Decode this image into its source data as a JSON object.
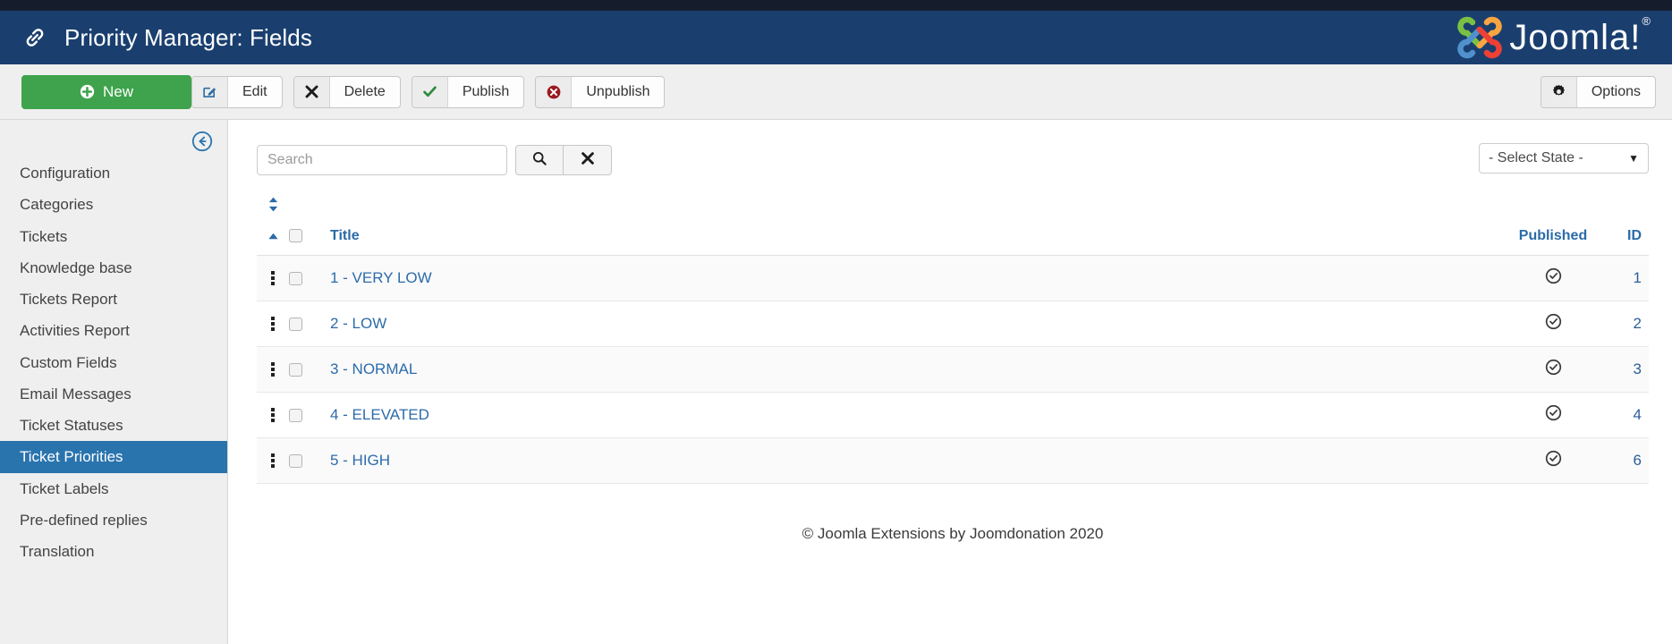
{
  "header": {
    "title": "Priority Manager: Fields",
    "icon": "chain-link-icon",
    "brand": "Joomla!",
    "brand_registered": "®",
    "bar_color": "#1a3f6f"
  },
  "toolbar": {
    "new_label": "New",
    "new_icon": "plus-circle-icon",
    "new_color": "#3ea34c",
    "edit_label": "Edit",
    "edit_icon": "pencil-square-icon",
    "delete_label": "Delete",
    "delete_icon": "x-mark-icon",
    "publish_label": "Publish",
    "publish_icon": "check-mark-icon",
    "unpublish_label": "Unpublish",
    "unpublish_icon": "circle-x-icon",
    "options_label": "Options",
    "options_icon": "gear-icon"
  },
  "sidebar": {
    "collapse_icon": "arrow-circle-left-icon",
    "active_color": "#2a74ae",
    "items": [
      {
        "label": "Configuration",
        "active": false
      },
      {
        "label": "Categories",
        "active": false
      },
      {
        "label": "Tickets",
        "active": false
      },
      {
        "label": "Knowledge base",
        "active": false
      },
      {
        "label": "Tickets Report",
        "active": false
      },
      {
        "label": "Activities Report",
        "active": false
      },
      {
        "label": "Custom Fields",
        "active": false
      },
      {
        "label": "Email Messages",
        "active": false
      },
      {
        "label": "Ticket Statuses",
        "active": false
      },
      {
        "label": "Ticket Priorities",
        "active": true
      },
      {
        "label": "Ticket Labels",
        "active": false
      },
      {
        "label": "Pre-defined replies",
        "active": false
      },
      {
        "label": "Translation",
        "active": false
      }
    ]
  },
  "filters": {
    "search_placeholder": "Search",
    "search_value": "",
    "search_icon": "magnifier-icon",
    "clear_icon": "x-mark-icon",
    "state_selected": "- Select State -",
    "state_caret": "▼"
  },
  "table": {
    "columns": {
      "ordering": "sort-arrows-icon",
      "ordering_active": "sort-asc-icon",
      "check_all": "select-all-checkbox",
      "title": "Title",
      "published": "Published",
      "id": "ID"
    },
    "rows": [
      {
        "title": "1 - VERY LOW",
        "published_icon": "circle-check-icon",
        "id": "1"
      },
      {
        "title": "2 - LOW",
        "published_icon": "circle-check-icon",
        "id": "2"
      },
      {
        "title": "3 - NORMAL",
        "published_icon": "circle-check-icon",
        "id": "3"
      },
      {
        "title": "4 - ELEVATED",
        "published_icon": "circle-check-icon",
        "id": "4"
      },
      {
        "title": "5 - HIGH",
        "published_icon": "circle-check-icon",
        "id": "6"
      }
    ]
  },
  "footer": {
    "text": "© Joomla Extensions by Joomdonation 2020"
  }
}
